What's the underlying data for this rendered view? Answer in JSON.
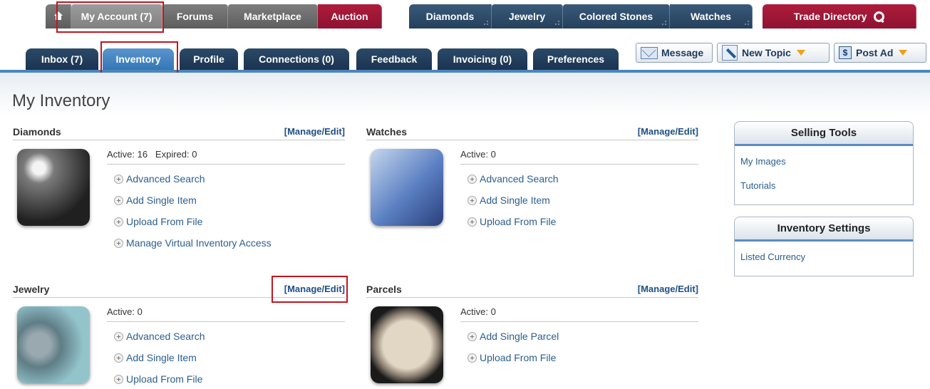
{
  "topnav": {
    "account": "My Account (7)",
    "forums": "Forums",
    "marketplace": "Marketplace",
    "auction": "Auction",
    "diamonds": "Diamonds",
    "jewelry": "Jewelry",
    "colored_stones": "Colored Stones",
    "watches": "Watches",
    "trade_directory": "Trade Directory"
  },
  "subtabs": {
    "inbox": "Inbox (7)",
    "inventory": "Inventory",
    "profile": "Profile",
    "connections": "Connections (0)",
    "feedback": "Feedback",
    "invoicing": "Invoicing (0)",
    "preferences": "Preferences"
  },
  "actions": {
    "message": "Message",
    "new_topic": "New Topic",
    "post_ad": "Post Ad"
  },
  "page": {
    "title": "My Inventory"
  },
  "sections": {
    "diamonds": {
      "title": "Diamonds",
      "edit": "[Manage/Edit]",
      "stats": "Active: 16   Expired: 0",
      "links": [
        "Advanced Search",
        "Add Single Item",
        "Upload From File",
        "Manage Virtual Inventory Access"
      ]
    },
    "watches": {
      "title": "Watches",
      "edit": "[Manage/Edit]",
      "stats": "Active: 0",
      "links": [
        "Advanced Search",
        "Add Single Item",
        "Upload From File"
      ]
    },
    "jewelry": {
      "title": "Jewelry",
      "edit": "[Manage/Edit]",
      "stats": "Active: 0",
      "links": [
        "Advanced Search",
        "Add Single Item",
        "Upload From File"
      ]
    },
    "parcels": {
      "title": "Parcels",
      "edit": "[Manage/Edit]",
      "stats": "Active: 0",
      "links": [
        "Add Single Parcel",
        "Upload From File"
      ]
    }
  },
  "sidebar": {
    "selling_tools": {
      "title": "Selling Tools",
      "links": [
        "My Images",
        "Tutorials"
      ]
    },
    "inventory_settings": {
      "title": "Inventory Settings",
      "links": [
        "Listed Currency"
      ]
    }
  }
}
